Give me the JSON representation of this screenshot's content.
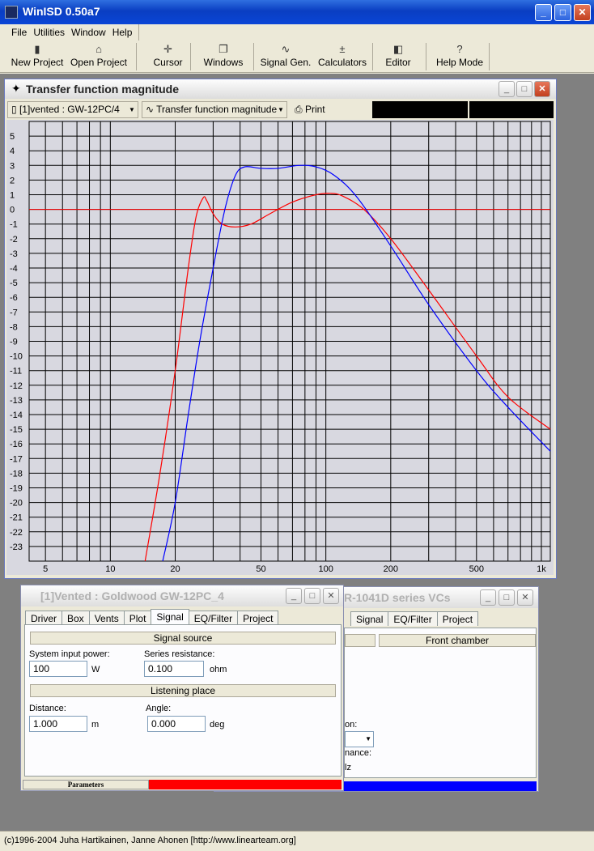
{
  "app": {
    "title": "WinISD 0.50a7"
  },
  "menu": [
    "File",
    "Utilities",
    "Window",
    "Help"
  ],
  "toolbar": [
    {
      "label": "New Project",
      "icon": "new-project-icon",
      "glyph": "▮"
    },
    {
      "label": "Open Project",
      "icon": "open-folder-icon",
      "glyph": "⌂"
    },
    {
      "label": "Cursor",
      "icon": "cursor-icon",
      "glyph": "✛"
    },
    {
      "label": "Windows",
      "icon": "windows-icon",
      "glyph": "❐"
    },
    {
      "label": "Signal Gen.",
      "icon": "signal-gen-icon",
      "glyph": "∿"
    },
    {
      "label": "Calculators",
      "icon": "calculator-icon",
      "glyph": "±"
    },
    {
      "label": "Editor",
      "icon": "editor-icon",
      "glyph": "◧"
    },
    {
      "label": "Help Mode",
      "icon": "help-icon",
      "glyph": "?"
    }
  ],
  "tf_window": {
    "title": "Transfer function magnitude",
    "project_combo": "[1]vented : GW-12PC/4",
    "graph_combo": "Transfer function magnitude",
    "print_label": "Print"
  },
  "chart_data": {
    "type": "line",
    "title": "",
    "xscale": "log",
    "xlim": [
      4.2,
      1100
    ],
    "ylim": [
      -24,
      6
    ],
    "x_ticks": [
      5,
      10,
      20,
      50,
      100,
      200,
      500,
      1000
    ],
    "x_tick_labels": [
      "5",
      "10",
      "20",
      "50",
      "100",
      "200",
      "500",
      "1k"
    ],
    "y_ticks": [
      5,
      4,
      3,
      2,
      1,
      0,
      -1,
      -2,
      -3,
      -4,
      -5,
      -6,
      -7,
      -8,
      -9,
      -10,
      -11,
      -12,
      -13,
      -14,
      -15,
      -16,
      -17,
      -18,
      -19,
      -20,
      -21,
      -22,
      -23
    ],
    "reference_line": 0,
    "grid": true,
    "series": [
      {
        "color": "#ff0000",
        "x": [
          14.5,
          17,
          20,
          23,
          25,
          27,
          28,
          30,
          33,
          38,
          45,
          55,
          70,
          90,
          105,
          120,
          150,
          200,
          300,
          500,
          700,
          1100
        ],
        "y": [
          -24,
          -18,
          -11,
          -4,
          -0.5,
          0.8,
          0.6,
          -0.3,
          -1.0,
          -1.2,
          -1.0,
          -0.3,
          0.5,
          1.0,
          1.1,
          0.9,
          0,
          -2,
          -5.5,
          -10,
          -12.8,
          -15
        ]
      },
      {
        "color": "#0000ff",
        "x": [
          17.5,
          20,
          23,
          26,
          30,
          34,
          38,
          42,
          50,
          60,
          75,
          90,
          110,
          140,
          200,
          300,
          500,
          700,
          1100
        ],
        "y": [
          -24,
          -20,
          -14,
          -9,
          -4,
          0,
          2.3,
          2.9,
          2.8,
          2.8,
          3.0,
          2.9,
          2.3,
          0.8,
          -2.5,
          -6.5,
          -11,
          -13.5,
          -16.5
        ]
      }
    ]
  },
  "params_window": {
    "title": "[1]Vented : Goldwood GW-12PC_4",
    "tabs": [
      "Driver",
      "Box",
      "Vents",
      "Plot",
      "Signal",
      "EQ/Filter",
      "Project"
    ],
    "active_tab": "Signal",
    "signal_source_header": "Signal source",
    "input_power_label": "System input power:",
    "input_power_value": "100",
    "input_power_unit": "W",
    "series_res_label": "Series resistance:",
    "series_res_value": "0.100",
    "series_res_unit": "ohm",
    "listening_header": "Listening place",
    "distance_label": "Distance:",
    "distance_value": "1.000",
    "distance_unit": "m",
    "angle_label": "Angle:",
    "angle_value": "0.000",
    "angle_unit": "deg",
    "status_label": "Parameters",
    "status_color": "#ff0000"
  },
  "back_window": {
    "title_fragment": "R-1041D series VCs",
    "tabs": [
      "Signal",
      "EQ/Filter",
      "Project"
    ],
    "front_chamber": "Front chamber",
    "frag_on": "on:",
    "frag_nance": "nance:",
    "frag_lz": "lz",
    "status_color": "#0000ff"
  },
  "statusbar": {
    "text": "(c)1996-2004 Juha Hartikainen, Janne Ahonen [http://www.linearteam.org]"
  }
}
